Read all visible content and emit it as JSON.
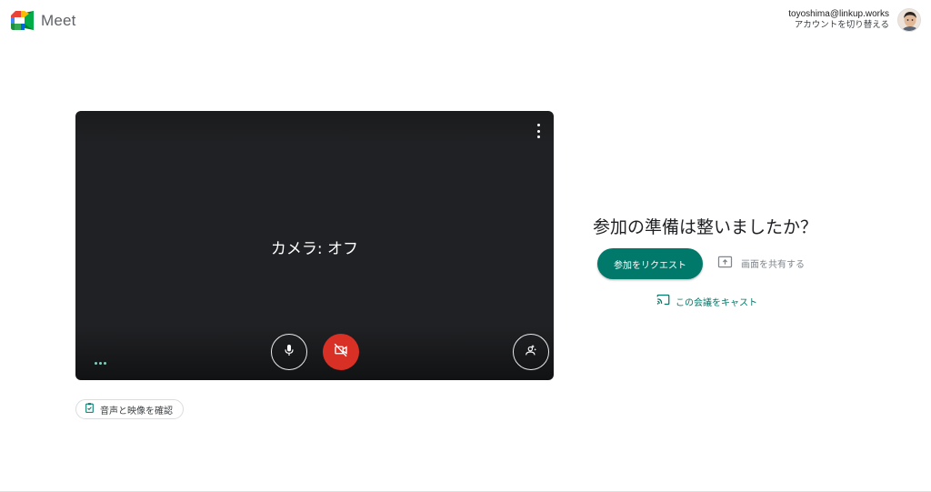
{
  "header": {
    "app_name": "Meet",
    "account_email": "toyoshima@linkup.works",
    "switch_account": "アカウントを切り替える"
  },
  "preview": {
    "camera_status": "カメラ: オフ",
    "mic_state": "on",
    "camera_state": "off"
  },
  "check_av_label": "音声と映像を確認",
  "join": {
    "ready_title": "参加の準備は整いましたか？",
    "request_button": "参加をリクエスト",
    "share_screen": "画面を共有する",
    "cast_meeting": "この会議をキャスト"
  },
  "colors": {
    "accent": "#00796b",
    "camera_off_red": "#d93025",
    "preview_bg": "#202124"
  },
  "icons": [
    "meet-logo-icon",
    "more-vert-icon",
    "mic-icon",
    "videocam-off-icon",
    "visual-effects-icon",
    "clipboard-check-icon",
    "present-to-all-icon",
    "cast-icon"
  ]
}
